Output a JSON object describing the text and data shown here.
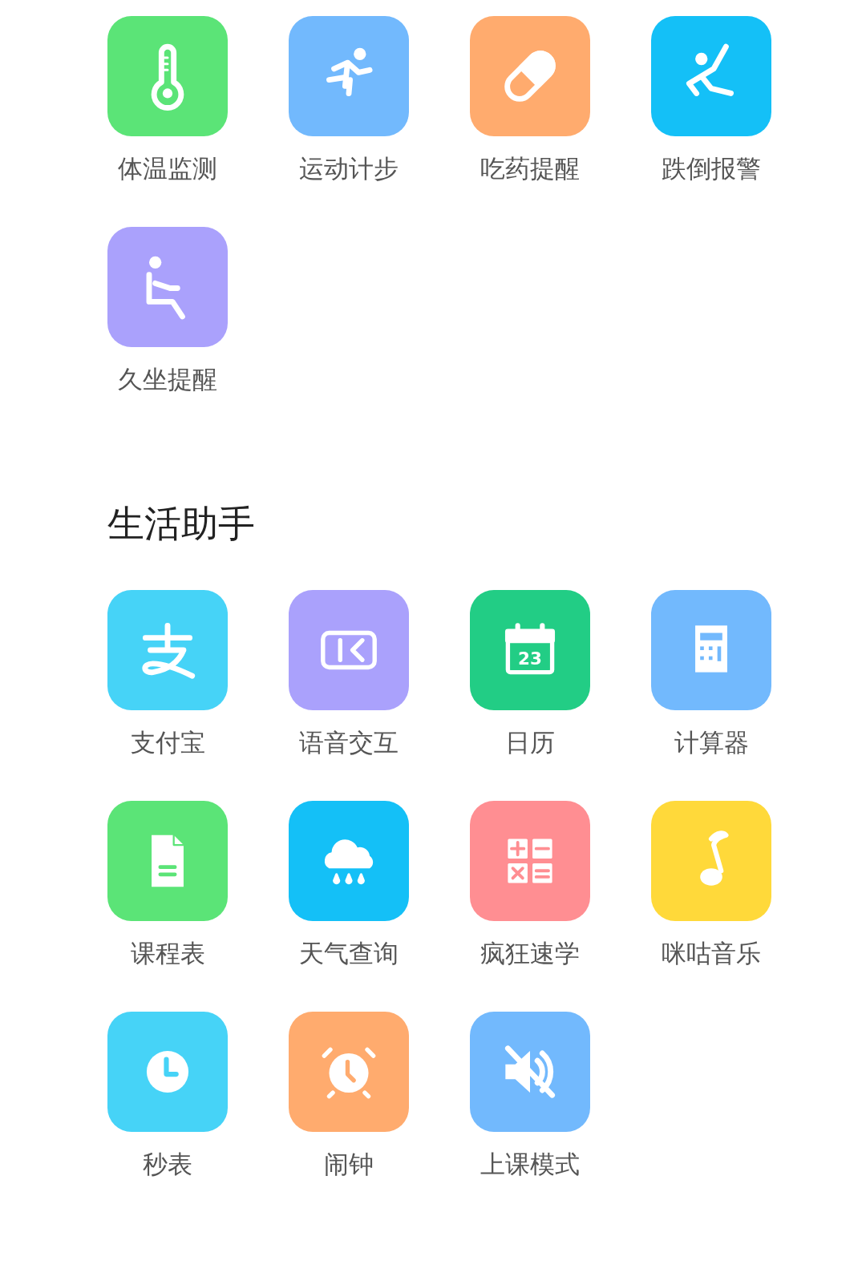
{
  "sections": [
    {
      "items": [
        {
          "label": "体温监测",
          "color": "#5be477"
        },
        {
          "label": "运动计步",
          "color": "#72b9fd"
        },
        {
          "label": "吃药提醒",
          "color": "#ffab6e"
        },
        {
          "label": "跌倒报警",
          "color": "#14c0f7"
        },
        {
          "label": "久坐提醒",
          "color": "#aaa1fc"
        }
      ]
    },
    {
      "title": "生活助手",
      "items": [
        {
          "label": "支付宝",
          "color": "#46d3f7"
        },
        {
          "label": "语音交互",
          "color": "#aaa1fc"
        },
        {
          "label": "日历",
          "color": "#22cd85",
          "badge": "23"
        },
        {
          "label": "计算器",
          "color": "#72b9fd"
        },
        {
          "label": "课程表",
          "color": "#5be477"
        },
        {
          "label": "天气查询",
          "color": "#14c0f7"
        },
        {
          "label": "疯狂速学",
          "color": "#ff8e92"
        },
        {
          "label": "咪咕音乐",
          "color": "#ffd93a"
        },
        {
          "label": "秒表",
          "color": "#46d3f7"
        },
        {
          "label": "闹钟",
          "color": "#ffab6e"
        },
        {
          "label": "上课模式",
          "color": "#72b9fd"
        }
      ]
    }
  ]
}
